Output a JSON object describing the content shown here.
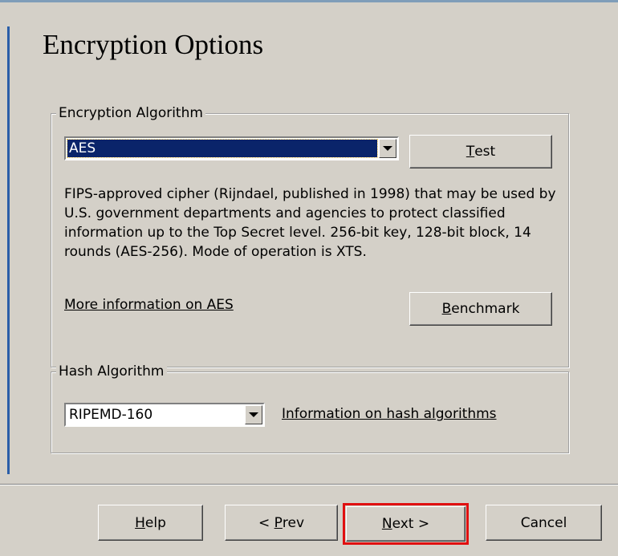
{
  "page": {
    "title": "Encryption Options"
  },
  "encryption": {
    "legend": "Encryption Algorithm",
    "selected": "AES",
    "test_button": {
      "prefix": "",
      "accel": "T",
      "rest": "est"
    },
    "description": "FIPS-approved cipher (Rijndael, published in 1998) that may be used by U.S. government departments and agencies to protect classified information up to the Top Secret level. 256-bit key, 128-bit block, 14 rounds (AES-256). Mode of operation is XTS.",
    "more_info_link": "More information on AES",
    "benchmark_button": {
      "prefix": "",
      "accel": "B",
      "rest": "enchmark"
    }
  },
  "hash": {
    "legend": "Hash Algorithm",
    "selected": "RIPEMD-160",
    "info_link": "Information on hash algorithms"
  },
  "buttons": {
    "help": {
      "prefix": "",
      "accel": "H",
      "rest": "elp"
    },
    "prev": {
      "prefix": "< ",
      "accel": "P",
      "rest": "rev"
    },
    "next": {
      "prefix": "",
      "accel": "N",
      "rest": "ext >"
    },
    "cancel": "Cancel"
  },
  "colors": {
    "selection": "#0a246a",
    "highlight_box": "#e01010",
    "dialog_bg": "#d4d0c8"
  },
  "icons": [
    "dropdown-arrow-icon"
  ]
}
